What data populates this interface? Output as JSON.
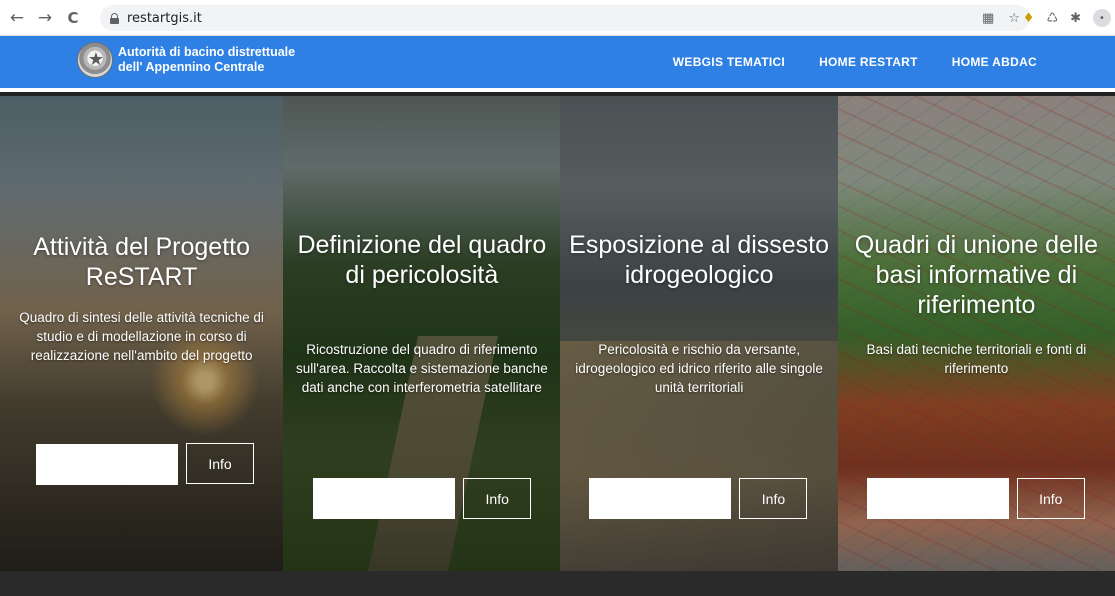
{
  "browser": {
    "back_icon": "←",
    "forward_icon": "→",
    "reload_icon": "C",
    "url": "restartgis.it",
    "omni_icons": [
      "qr-icon",
      "star-icon"
    ],
    "omni_glyphs": [
      "▦",
      "☆"
    ],
    "ext_glyphs": [
      "♦",
      "♺",
      "✱",
      "•"
    ]
  },
  "header": {
    "org_line1": "Autorità di bacino distrettuale",
    "org_line2": "dell' Appennino Centrale",
    "nav": [
      "WEBGIS TEMATICI",
      "HOME RESTART",
      "HOME ABDAC"
    ],
    "colors": {
      "bar": "#2f80e4"
    }
  },
  "panels": [
    {
      "title": "Attività del Progetto ReSTART",
      "description": "Quadro di sintesi delle attività tecniche di studio e di modellazione in corso di realizzazione nell'ambito del progetto",
      "info_label": "Info"
    },
    {
      "title": "Definizione del quadro di pericolosità",
      "description": "Ricostruzione del quadro di riferimento sull'area. Raccolta e sistemazione banche dati anche con interferometria satellitare",
      "info_label": "Info"
    },
    {
      "title": "Esposizione al dissesto idrogeologico",
      "description": "Pericolosità e rischio da versante, idrogeologico ed idrico riferito alle singole unità territoriali",
      "info_label": "Info"
    },
    {
      "title": "Quadri di unione delle basi informative di riferimento",
      "description": "Basi dati tecniche territoriali e fonti di riferimento",
      "info_label": "Info"
    }
  ]
}
